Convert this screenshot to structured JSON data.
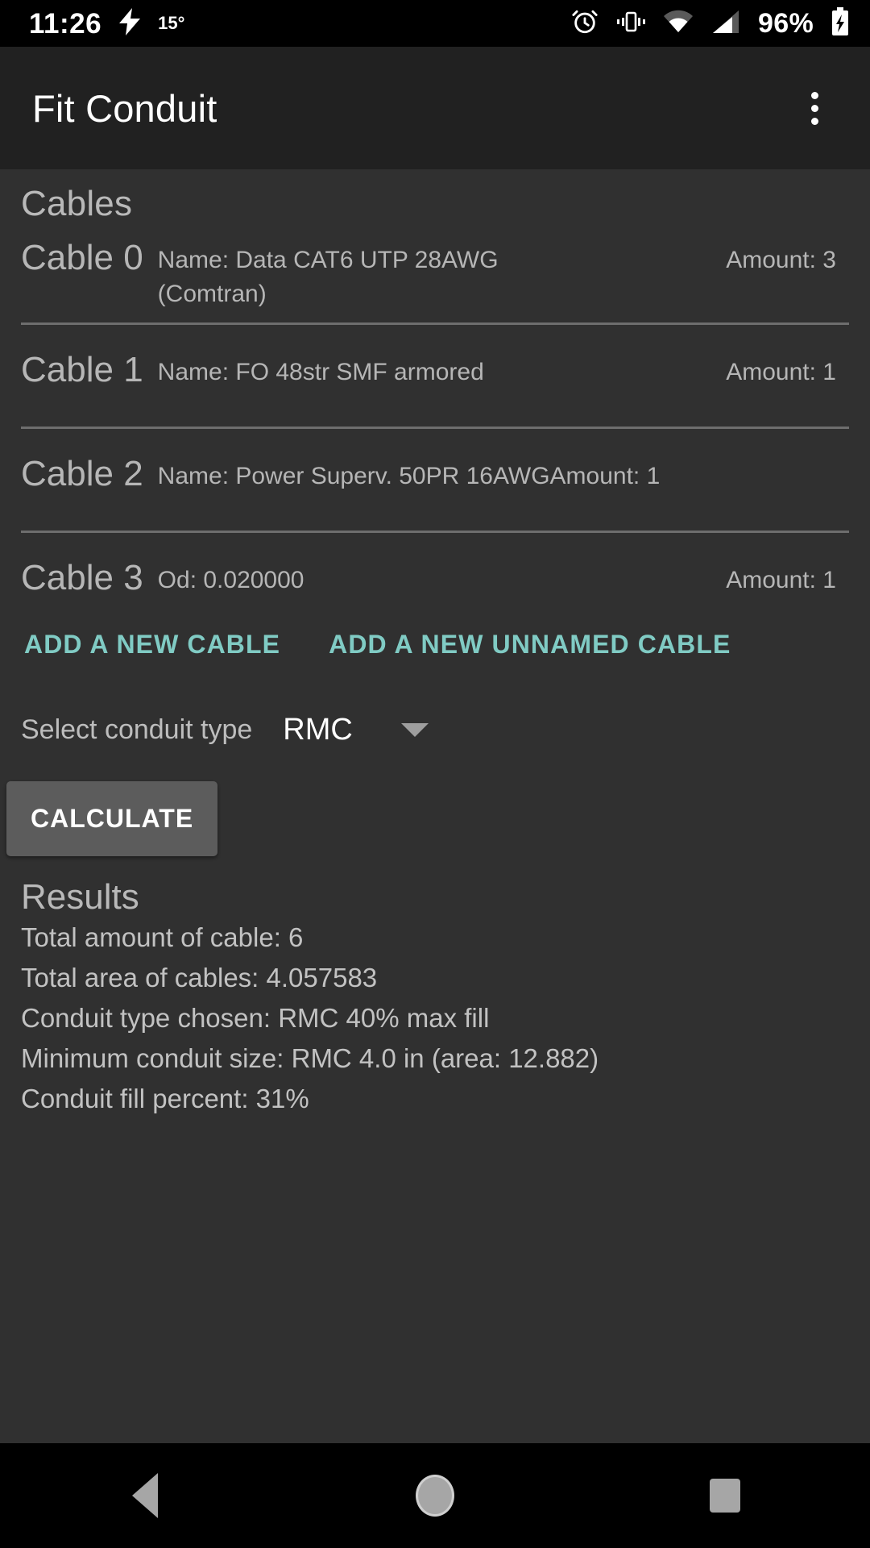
{
  "status_bar": {
    "time": "11:26",
    "temperature": "15°",
    "battery_percent": "96%",
    "icons": [
      "bolt-icon",
      "alarm-icon",
      "vibrate-icon",
      "wifi-icon",
      "cell-signal-icon",
      "battery-charging-icon"
    ]
  },
  "app_bar": {
    "title": "Fit Conduit",
    "overflow_label": "More options"
  },
  "cables_section": {
    "heading": "Cables",
    "items": [
      {
        "id": "Cable 0",
        "detail": "Name: Data CAT6 UTP 28AWG (Comtran)",
        "amount": "Amount: 3",
        "layout": "wrap"
      },
      {
        "id": "Cable 1",
        "detail": "Name: FO 48str SMF armored",
        "amount": "Amount: 1",
        "layout": "right"
      },
      {
        "id": "Cable 2",
        "detail": "Name: Power Superv. 50PR 16AWG",
        "amount": "Amount: 1",
        "layout": "abut"
      },
      {
        "id": "Cable 3",
        "detail": "Od: 0.020000",
        "amount": "Amount: 1",
        "layout": "right"
      }
    ]
  },
  "actions": {
    "add_cable": "ADD A NEW CABLE",
    "add_unnamed_cable": "ADD A NEW UNNAMED CABLE",
    "calculate": "CALCULATE"
  },
  "conduit_selector": {
    "label": "Select conduit type",
    "selected": "RMC"
  },
  "results": {
    "heading": "Results",
    "lines": [
      "Total amount of cable: 6",
      "Total area of cables: 4.057583",
      "Conduit type chosen: RMC 40% max fill",
      "Minimum conduit size: RMC 4.0 in (area: 12.882)",
      "Conduit fill percent: 31%"
    ]
  },
  "nav_bar": {
    "back": "Back",
    "home": "Home",
    "recents": "Recents"
  },
  "colors": {
    "accent_teal": "#80cbc4",
    "app_bar": "#212121",
    "background": "#303030",
    "text_primary": "#c2c2c2",
    "button_gray": "#5c5c5c"
  }
}
